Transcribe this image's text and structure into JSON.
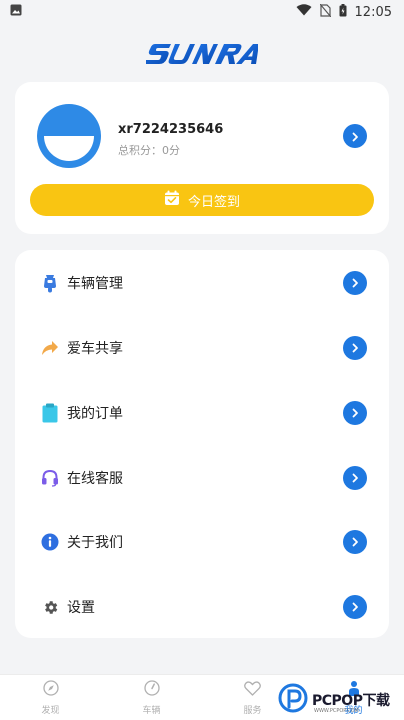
{
  "status_bar": {
    "time": "12:05"
  },
  "logo": {
    "text": "SUNRA"
  },
  "profile": {
    "user_id": "xr7224235646",
    "points": "总积分：0分",
    "checkin_label": "今日签到"
  },
  "menu": {
    "items": [
      {
        "label": "车辆管理",
        "icon": "scooter-icon",
        "color": "#3a7be0"
      },
      {
        "label": "爱车共享",
        "icon": "share-arrow-icon",
        "color": "#f2a94a"
      },
      {
        "label": "我的订单",
        "icon": "clipboard-icon",
        "color": "#3ac7e8"
      },
      {
        "label": "在线客服",
        "icon": "headset-icon",
        "color": "#7b5ce8"
      },
      {
        "label": "关于我们",
        "icon": "info-icon",
        "color": "#2e6fe0"
      },
      {
        "label": "设置",
        "icon": "gear-icon",
        "color": "#555555"
      }
    ]
  },
  "bottom_nav": {
    "items": [
      {
        "label": "发现",
        "icon": "compass-icon"
      },
      {
        "label": "车辆",
        "icon": "speedometer-icon"
      },
      {
        "label": "服务",
        "icon": "heart-icon"
      },
      {
        "label": "我的",
        "icon": "person-icon",
        "active": true
      }
    ]
  },
  "watermark": {
    "text": "PCPOP下载",
    "sub": "WWW.PCPOP.COM"
  },
  "colors": {
    "accent": "#1e78e0",
    "checkin": "#f9c512",
    "background": "#f3f4f6"
  }
}
